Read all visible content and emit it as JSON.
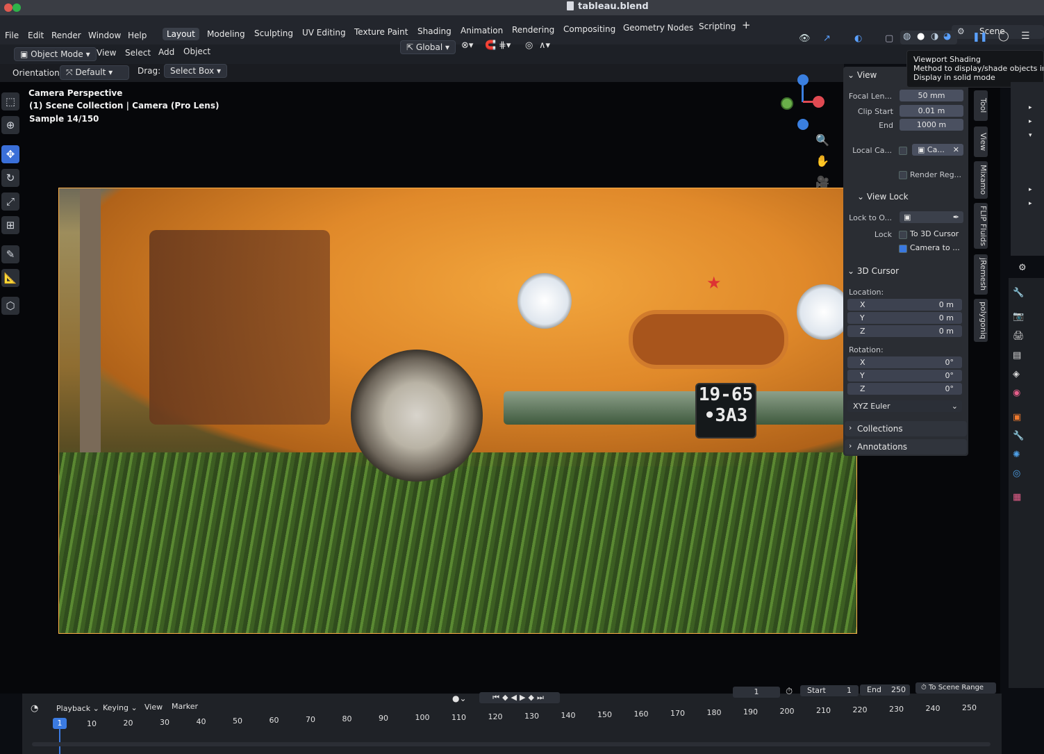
{
  "window": {
    "title": "tableau.blend"
  },
  "menu": [
    "File",
    "Edit",
    "Render",
    "Window",
    "Help"
  ],
  "workspaces": [
    "Layout",
    "Modeling",
    "Sculpting",
    "UV Editing",
    "Texture Paint",
    "Shading",
    "Animation",
    "Rendering",
    "Compositing",
    "Geometry Nodes",
    "Scripting"
  ],
  "active_workspace": "Layout",
  "add_workspace": "+",
  "scene": {
    "label": "Scene"
  },
  "header": {
    "mode": "Object Mode",
    "view": "View",
    "select": "Select",
    "add": "Add",
    "object": "Object",
    "transform": "Global"
  },
  "tool_settings": {
    "orientation_label": "Orientation:",
    "orientation_value": "Default",
    "drag_label": "Drag:",
    "drag_value": "Select Box"
  },
  "viewport_overlay": {
    "line1": "Camera Perspective",
    "line2": "(1) Scene Collection | Camera (Pro Lens)",
    "line3": "Sample 14/150"
  },
  "render": {
    "plate_top": "19-65",
    "plate_bottom": "•ЗАЗ"
  },
  "gizmo": {
    "y_label": "y",
    "z_label": "z"
  },
  "tooltip": {
    "title": "Viewport Shading",
    "line1": "Method to display/shade objects in the",
    "line2": "Display in solid mode"
  },
  "npanel": {
    "view": {
      "header": "View",
      "focal_label": "Focal Len...",
      "focal_value": "50 mm",
      "clip_start_label": "Clip Start",
      "clip_start_value": "0.01 m",
      "clip_end_label": "End",
      "clip_end_value": "1000 m",
      "local_camera_label": "Local Ca...",
      "local_camera_value": "Ca...",
      "render_region_label": "Render Reg..."
    },
    "view_lock": {
      "header": "View Lock",
      "lock_to_object_label": "Lock to O...",
      "lock_label": "Lock",
      "to_3d_cursor": "To 3D Cursor",
      "camera_to": "Camera to ..."
    },
    "cursor": {
      "header": "3D Cursor",
      "location_label": "Location:",
      "location": [
        {
          "axis": "X",
          "value": "0 m"
        },
        {
          "axis": "Y",
          "value": "0 m"
        },
        {
          "axis": "Z",
          "value": "0 m"
        }
      ],
      "rotation_label": "Rotation:",
      "rotation": [
        {
          "axis": "X",
          "value": "0°"
        },
        {
          "axis": "Y",
          "value": "0°"
        },
        {
          "axis": "Z",
          "value": "0°"
        }
      ],
      "mode": "XYZ Euler"
    },
    "collections": "Collections",
    "annotations": "Annotations"
  },
  "vtabs": [
    "Tool",
    "View",
    "Mixamo",
    "FLIP Fluids",
    "jRemesh",
    "polygoniq"
  ],
  "timeline": {
    "playback": "Playback",
    "keying": "Keying",
    "view": "View",
    "marker": "Marker",
    "current_frame": "1",
    "start_label": "Start",
    "start_value": "1",
    "end_label": "End",
    "end_value": "250",
    "to_scene_range": "To Scene Range",
    "ruler": [
      "10",
      "20",
      "30",
      "40",
      "50",
      "60",
      "70",
      "80",
      "90",
      "100",
      "110",
      "120",
      "130",
      "140",
      "150",
      "160",
      "170",
      "180",
      "190",
      "200",
      "210",
      "220",
      "230",
      "240",
      "250"
    ],
    "playhead_label": "1"
  }
}
